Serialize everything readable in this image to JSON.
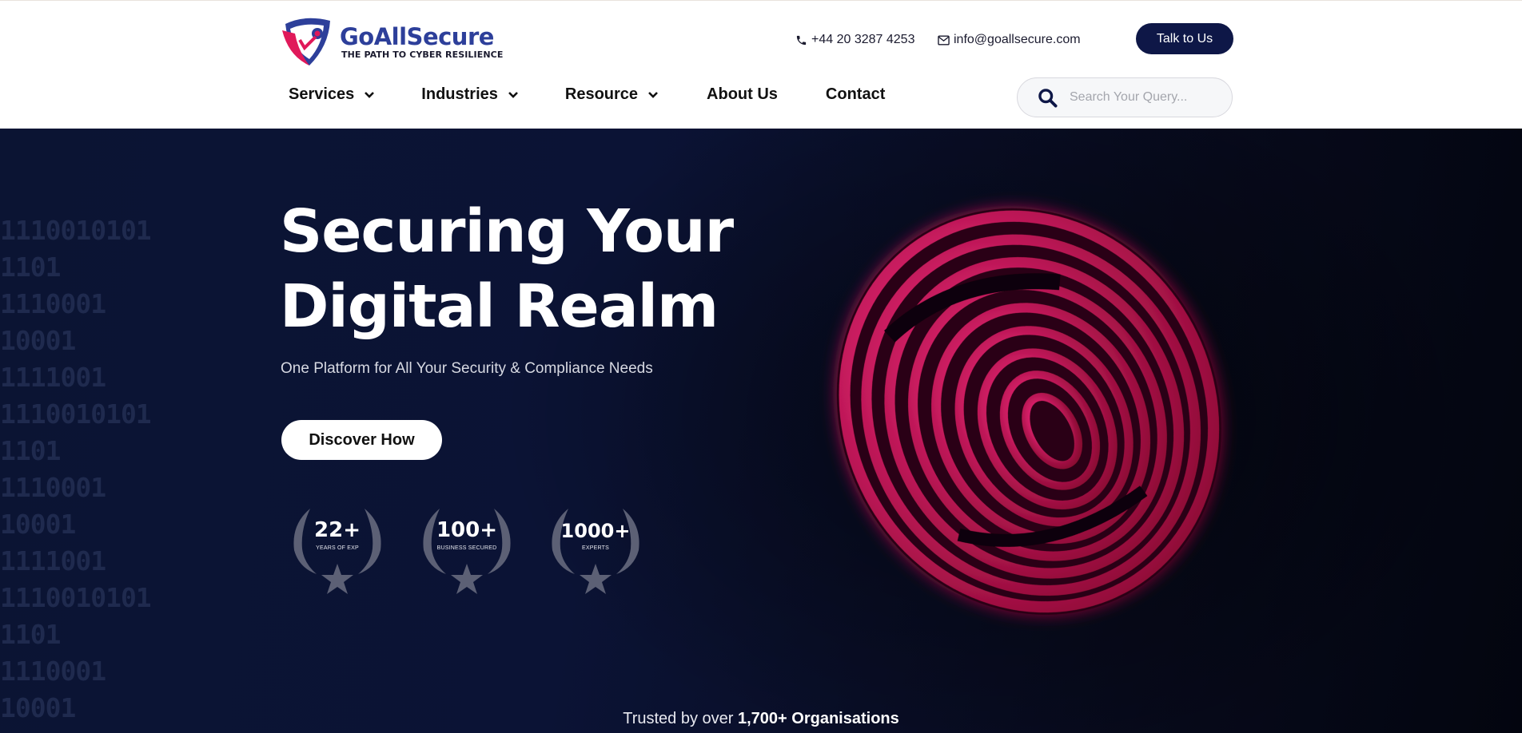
{
  "brand": {
    "name": "GoAllSecure",
    "tagline": "THE PATH TO CYBER RESILIENCE",
    "primary_color": "#0e1747",
    "accent_color": "#e0195a"
  },
  "header": {
    "phone": "+44 20 3287 4253",
    "email": "info@goallsecure.com",
    "cta_label": "Talk to Us"
  },
  "nav": {
    "items": [
      {
        "label": "Services",
        "has_dropdown": true
      },
      {
        "label": "Industries",
        "has_dropdown": true
      },
      {
        "label": "Resource",
        "has_dropdown": true
      },
      {
        "label": "About Us",
        "has_dropdown": false
      },
      {
        "label": "Contact",
        "has_dropdown": false
      }
    ]
  },
  "search": {
    "placeholder": "Search Your Query...",
    "value": ""
  },
  "hero": {
    "title_line1": "Securing Your",
    "title_line2": "Digital Realm",
    "subtitle": "One Platform for All Your Security & Compliance Needs",
    "cta_label": "Discover How",
    "binary_lines": [
      "1110010101",
      "1101",
      "1110001",
      "10001",
      "1111001",
      "1110010101",
      "1101",
      "1110001",
      "10001",
      "1111001",
      "1110010101",
      "1101",
      "1110001",
      "10001"
    ],
    "badges": [
      {
        "number": "22+",
        "label": "YEARS OF EXP"
      },
      {
        "number": "100+",
        "label": "BUSINESS SECURED"
      },
      {
        "number": "1000+",
        "label": "EXPERTS"
      }
    ]
  },
  "trusted": {
    "prefix": "Trusted by over",
    "highlight": "1,700+ Organisations"
  }
}
